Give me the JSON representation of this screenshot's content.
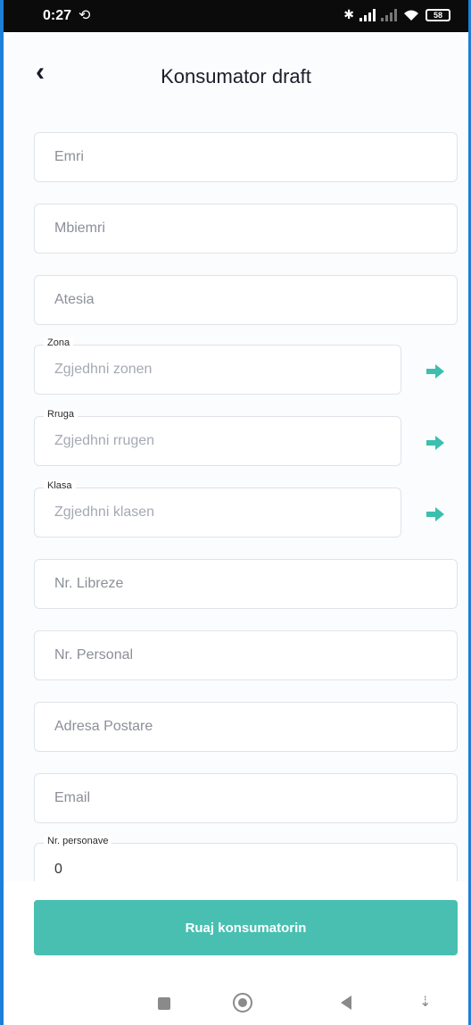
{
  "status_bar": {
    "time": "0:27",
    "sync_icon": "sync-off-icon",
    "battery": "58"
  },
  "header": {
    "title": "Konsumator draft",
    "back_icon": "chevron-left-icon"
  },
  "form": {
    "emri_placeholder": "Emri",
    "mbiemri_placeholder": "Mbiemri",
    "atesia_placeholder": "Atesia",
    "zona": {
      "label": "Zona",
      "placeholder": "Zgjedhni zonen"
    },
    "rruga": {
      "label": "Rruga",
      "placeholder": "Zgjedhni rrugen"
    },
    "klasa": {
      "label": "Klasa",
      "placeholder": "Zgjedhni klasen"
    },
    "nr_libreze_placeholder": "Nr. Libreze",
    "nr_personal_placeholder": "Nr. Personal",
    "adresa_placeholder": "Adresa Postare",
    "email_placeholder": "Email",
    "nr_personave": {
      "label": "Nr. personave",
      "value": "0"
    }
  },
  "actions": {
    "save_label": "Ruaj konsumatorin"
  },
  "colors": {
    "accent": "#48bfb1",
    "arrow": "#3bbfae"
  }
}
